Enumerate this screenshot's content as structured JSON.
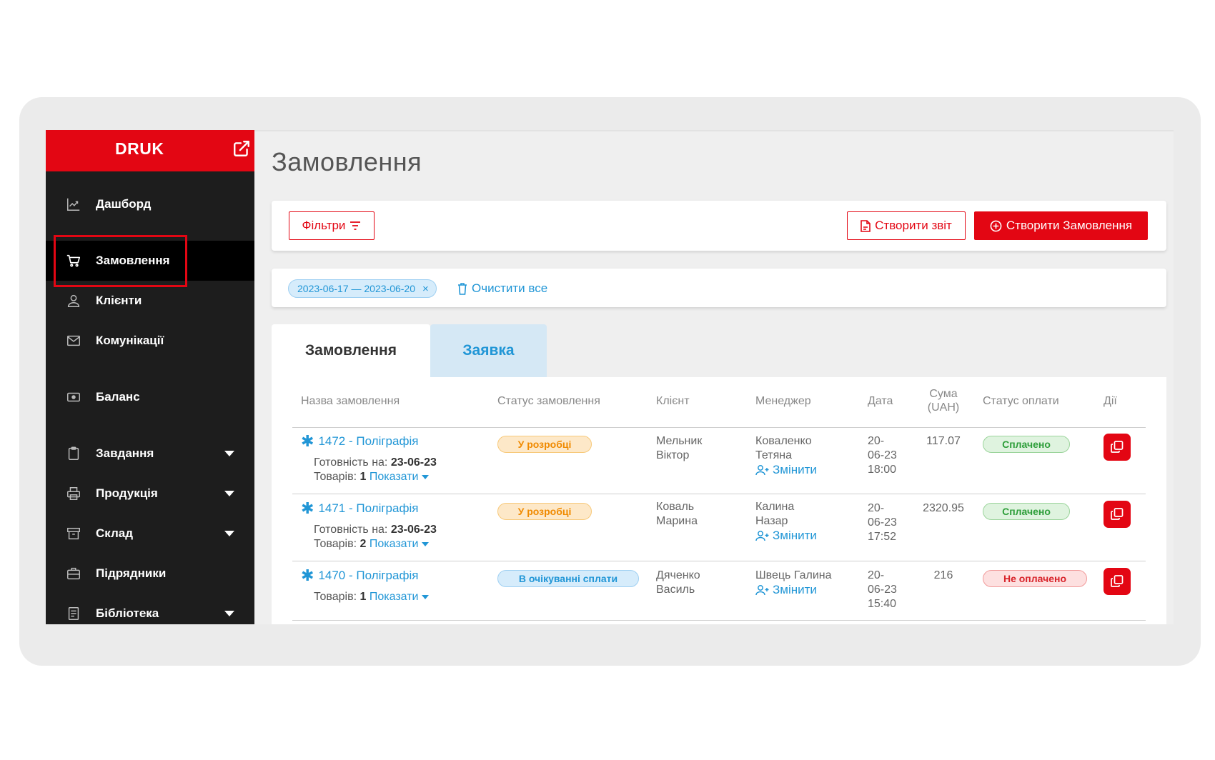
{
  "sidebar": {
    "logo": "DRUK",
    "items": [
      {
        "label": "Дашборд",
        "icon": "chart-icon",
        "caret": false
      },
      {
        "label": "Замовлення",
        "icon": "cart-icon",
        "caret": false,
        "active": true
      },
      {
        "label": "Клієнти",
        "icon": "user-icon",
        "caret": false
      },
      {
        "label": "Комунікації",
        "icon": "mail-icon",
        "caret": false
      },
      {
        "label": "Баланс",
        "icon": "wallet-icon",
        "caret": false
      },
      {
        "label": "Завдання",
        "icon": "clipboard-icon",
        "caret": true
      },
      {
        "label": "Продукція",
        "icon": "printer-icon",
        "caret": true
      },
      {
        "label": "Склад",
        "icon": "archive-icon",
        "caret": true
      },
      {
        "label": "Підрядники",
        "icon": "briefcase-icon",
        "caret": false
      },
      {
        "label": "Бібліотека",
        "icon": "book-icon",
        "caret": true
      }
    ]
  },
  "header": {
    "title": "Замовлення"
  },
  "toolbar": {
    "filters_label": "Фільтри",
    "report_label": "Створити звіт",
    "create_label": "Створити Замовлення"
  },
  "filters": {
    "date_chip": "2023-06-17 — 2023-06-20",
    "clear_all": "Очистити все"
  },
  "tabs": [
    {
      "label": "Замовлення",
      "active": true
    },
    {
      "label": "Заявка",
      "active": false
    }
  ],
  "table": {
    "headers": {
      "name": "Назва замовлення",
      "status": "Статус замовлення",
      "client": "Клієнт",
      "manager": "Менеджер",
      "date": "Дата",
      "sum_line1": "Сума",
      "sum_line2": "(UAH)",
      "payment": "Статус оплати",
      "actions": "Дії"
    },
    "labels": {
      "ready": "Готовність на:",
      "goods": "Товарів:",
      "show": "Показати",
      "change": "Змінити"
    },
    "rows": [
      {
        "title": "1472 - Поліграфія",
        "ready_date": "23-06-23",
        "goods": "1",
        "status": "У розробці",
        "client_1": "Мельник",
        "client_2": "Віктор",
        "manager_1": "Коваленко",
        "manager_2": "Тетяна",
        "date_1": "20-",
        "date_2": "06-23",
        "date_3": "18:00",
        "sum": "117.07",
        "payment": "Сплачено"
      },
      {
        "title": "1471 - Поліграфія",
        "ready_date": "23-06-23",
        "goods": "2",
        "status": "У розробці",
        "client_1": "Коваль",
        "client_2": "Марина",
        "manager_1": "Калина",
        "manager_2": "Назар",
        "date_1": "20-",
        "date_2": "06-23",
        "date_3": "17:52",
        "sum": "2320.95",
        "payment": "Сплачено"
      },
      {
        "title": "1470 - Поліграфія",
        "goods": "1",
        "status": "В очікуванні сплати",
        "client_1": "Дяченко",
        "client_2": "Василь",
        "manager_1": "Швець Галина",
        "date_1": "20-",
        "date_2": "06-23",
        "date_3": "15:40",
        "sum": "216",
        "payment": "Не оплачено"
      }
    ]
  },
  "colors": {
    "brand_red": "#e30613",
    "link_blue": "#2196d6",
    "sidebar_bg": "#1d1d1d"
  }
}
